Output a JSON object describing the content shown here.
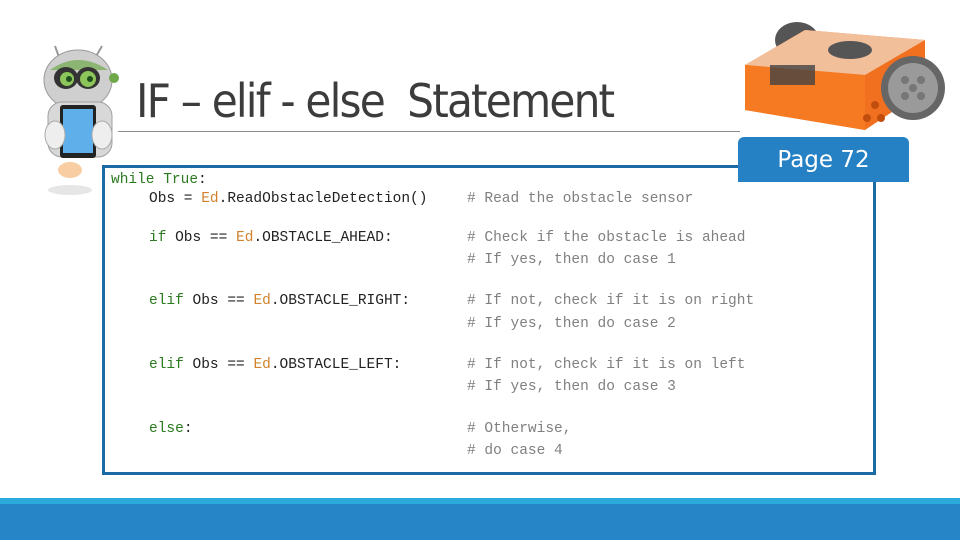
{
  "slide": {
    "title": "IF – elif - else  Statement",
    "page_badge": "Page 72"
  },
  "colors": {
    "accent_blue": "#2581c4",
    "box_border": "#1c6aa3",
    "footer_blue": "#2585c7",
    "footer_strip": "#2aa9dc",
    "keyword_green": "#2b7a1f",
    "object_orange": "#d2822e",
    "comment_gray": "#808080"
  },
  "code": {
    "line1": {
      "kw1": "while",
      "kw2": "True",
      "rest": ":"
    },
    "line2": {
      "pre": "Obs = ",
      "obj": "Ed",
      "post": ".ReadObstacleDetection()",
      "comment": "# Read the obstacle sensor"
    },
    "line3": {
      "kw": "if",
      "pre": " Obs == ",
      "obj": "Ed",
      "post": ".OBSTACLE_AHEAD:",
      "comment1": "# Check if the obstacle is ahead",
      "comment2": "# If yes, then do case 1"
    },
    "line4": {
      "kw": "elif",
      "pre": " Obs == ",
      "obj": "Ed",
      "post": ".OBSTACLE_RIGHT:",
      "comment1": "# If not, check if it is on right",
      "comment2": "# If yes, then do case 2"
    },
    "line5": {
      "kw": "elif",
      "pre": " Obs == ",
      "obj": "Ed",
      "post": ".OBSTACLE_LEFT:",
      "comment1": "# If not, check if it is on left",
      "comment2": "# If yes, then do case 3"
    },
    "line6": {
      "kw": "else",
      "post": ":",
      "comment1": "# Otherwise,",
      "comment2": "# do case 4"
    }
  },
  "images": {
    "mascot": "robot-mascot-holding-tablet",
    "edison": "edison-robot"
  }
}
